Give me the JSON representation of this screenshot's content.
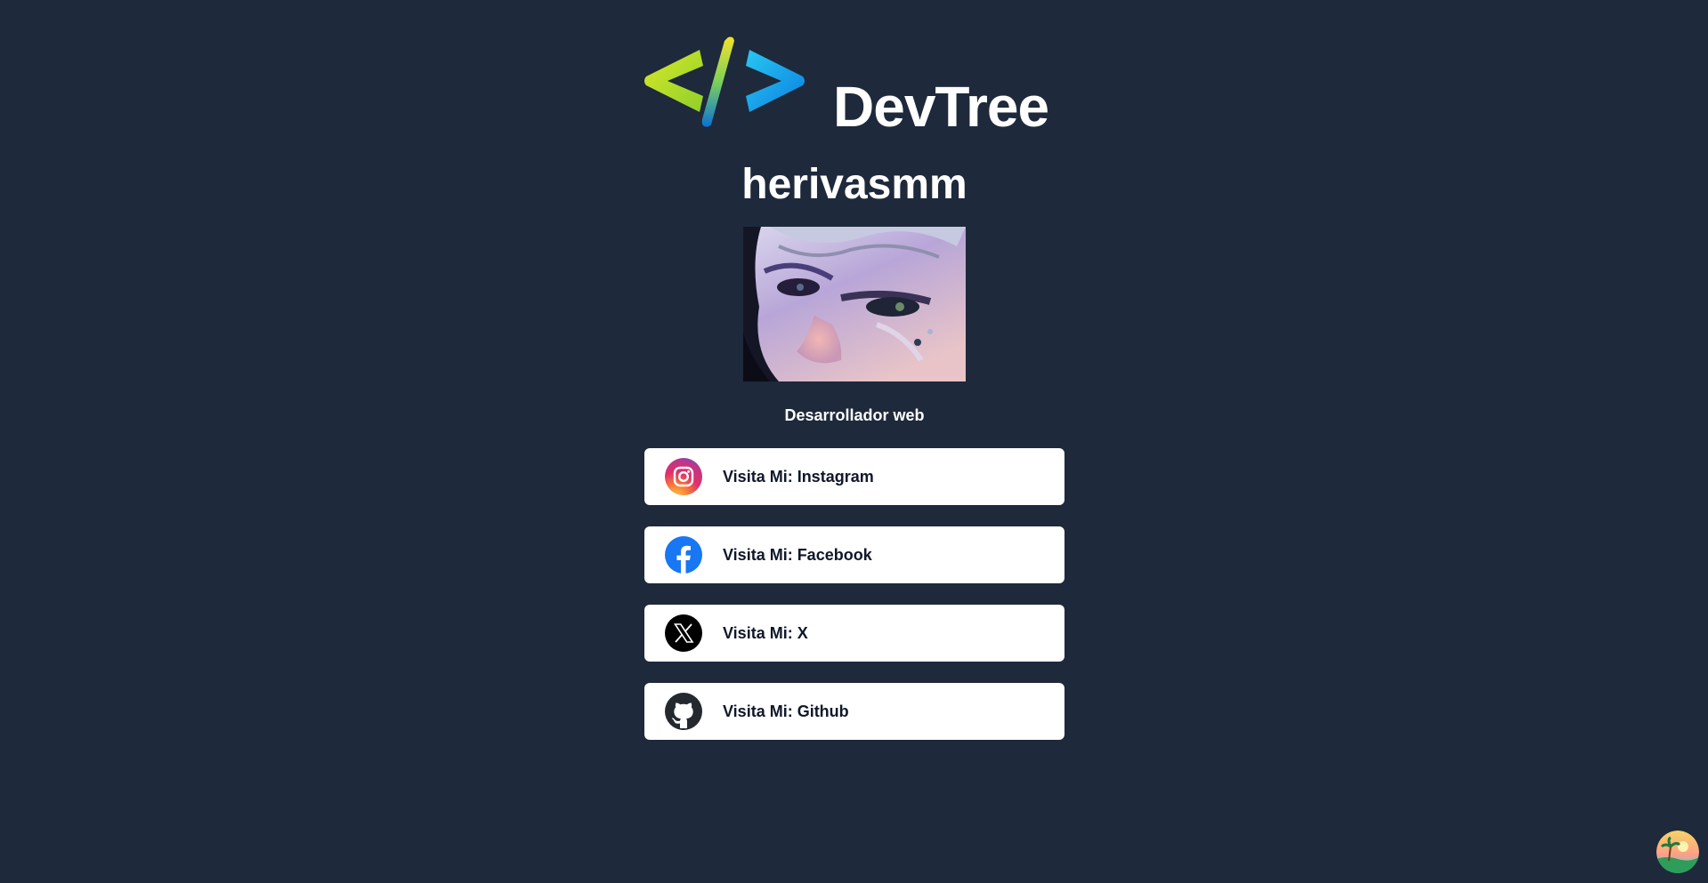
{
  "logo": {
    "wordmark": "DevTree"
  },
  "profile": {
    "handle": "herivasmm",
    "bio": "Desarrollador web"
  },
  "links": [
    {
      "label": "Visita Mi: Instagram",
      "icon": "instagram-icon"
    },
    {
      "label": "Visita Mi: Facebook",
      "icon": "facebook-icon"
    },
    {
      "label": "Visita Mi: X",
      "icon": "x-icon"
    },
    {
      "label": "Visita Mi: Github",
      "icon": "github-icon"
    }
  ],
  "colors": {
    "page_background": "#1e293b",
    "card_background": "#ffffff",
    "text_light": "#ffffff",
    "text_dark": "#0f172a",
    "logo_green": "#c3e02a",
    "logo_blue": "#0ea5e9",
    "facebook": "#1877f2"
  }
}
